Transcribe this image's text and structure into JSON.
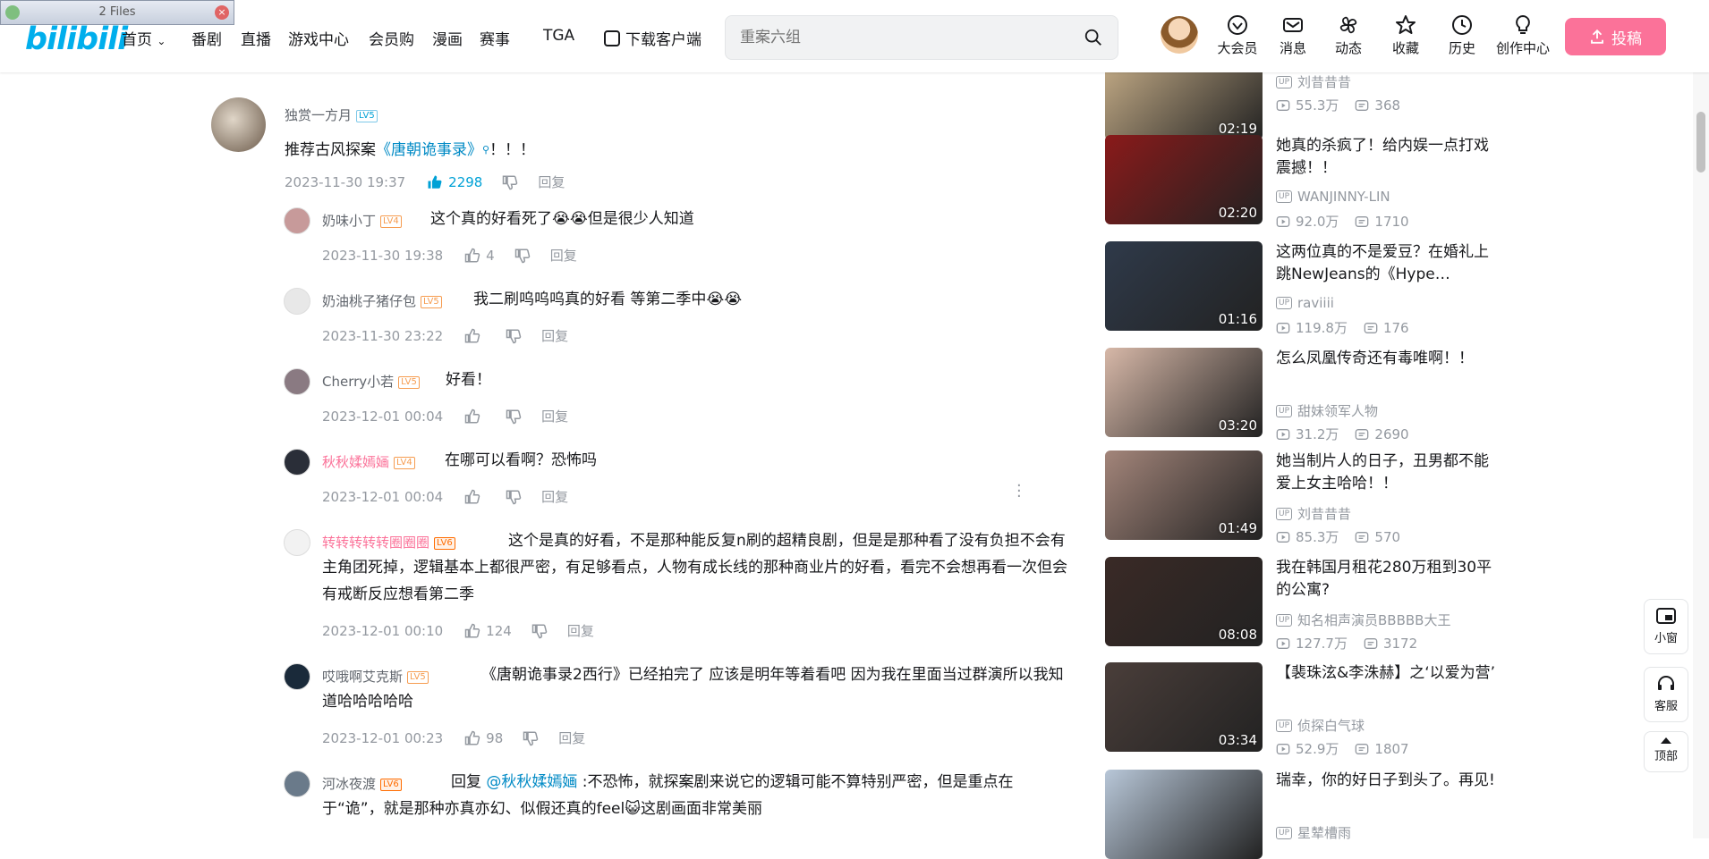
{
  "files_bar": {
    "label": "2 Files",
    "close": "×"
  },
  "header": {
    "logo": "bilibili",
    "nav": [
      {
        "label": "首页",
        "has_caret": true
      },
      {
        "label": "番剧"
      },
      {
        "label": "直播"
      },
      {
        "label": "游戏中心"
      },
      {
        "label": "会员购"
      },
      {
        "label": "漫画"
      },
      {
        "label": "赛事"
      },
      {
        "label": "TGA"
      },
      {
        "label": "下载客户端"
      }
    ],
    "search_placeholder": "重案六组",
    "icons": [
      {
        "label": "大会员",
        "icon": "vip-icon"
      },
      {
        "label": "消息",
        "icon": "message-icon"
      },
      {
        "label": "动态",
        "icon": "dynamic-icon"
      },
      {
        "label": "收藏",
        "icon": "favorite-icon"
      },
      {
        "label": "历史",
        "icon": "history-icon"
      },
      {
        "label": "创作中心",
        "icon": "creator-icon"
      }
    ],
    "upload_label": "投稿"
  },
  "comments": {
    "main": {
      "user": "独赏一方月",
      "level": "LV5",
      "text_before": "推荐古风探案",
      "link": "《唐朝诡事录》",
      "text_after": "！！！",
      "time": "2023-11-30 19:37",
      "likes": "2298",
      "reply_label": "回复"
    },
    "replies": [
      {
        "user": "奶味小丁",
        "level": "LV4",
        "text": "这个真的好看死了😭😭但是很少人知道",
        "time": "2023-11-30 19:38",
        "likes": "4",
        "reply_label": "回复"
      },
      {
        "user": "奶油桃子猪仔包",
        "level": "LV5",
        "text": "我二刷呜呜呜真的好看 等第二季中😭😭",
        "time": "2023-11-30 23:22",
        "likes": "",
        "reply_label": "回复"
      },
      {
        "user": "Cherry小若",
        "level": "LV5",
        "text": "好看！",
        "time": "2023-12-01 00:04",
        "likes": "",
        "reply_label": "回复"
      },
      {
        "user": "秋秋媃嫣婳",
        "level": "LV4",
        "text": "在哪可以看啊？恐怖吗",
        "time": "2023-12-01 00:04",
        "likes": "",
        "reply_label": "回复"
      },
      {
        "user": "转转转转转圈圈圈",
        "level": "LV6",
        "text": "这个是真的好看，不是那种能反复n刷的超精良剧，但是是那种看了没有负担不会有主角团死掉，逻辑基本上都很严密，有足够看点，人物有成长线的那种商业片的好看，看完不会想再看一次但会有戒断反应想看第二季",
        "time": "2023-12-01 00:10",
        "likes": "124",
        "reply_label": "回复"
      },
      {
        "user": "哎哦啊艾克斯",
        "level": "LV5",
        "text": "《唐朝诡事录2西行》已经拍完了 应该是明年等着看吧 因为我在里面当过群演所以我知道哈哈哈哈哈",
        "time": "2023-12-01 00:23",
        "likes": "98",
        "reply_label": "回复"
      },
      {
        "user": "河冰夜渡",
        "level": "LV6",
        "text_before": "回复 ",
        "mention": "@秋秋媃嫣婳",
        "text_after": " :不恐怖，就探案剧来说它的逻辑可能不算特别严密，但是重点在于“诡”，就是那种亦真亦幻、似假还真的feel😺这剧画面非常美丽"
      }
    ]
  },
  "recommendations": [
    {
      "title": "",
      "up": "刘昔昔昔",
      "views": "55.3万",
      "danmaku": "368",
      "duration": "02:19",
      "color": "#c9b08a"
    },
    {
      "title": "她真的杀疯了！给内娱一点打戏震撼！！",
      "up": "WANJINNY-LIN",
      "views": "92.0万",
      "danmaku": "1710",
      "duration": "02:20",
      "color": "#8a1a1a"
    },
    {
      "title": "这两位真的不是爱豆？在婚礼上跳NewJeans的《Hype…",
      "up": "raviiii",
      "views": "119.8万",
      "danmaku": "176",
      "duration": "01:16",
      "color": "#2f3a4a"
    },
    {
      "title": "怎么凤凰传奇还有毒唯啊！！",
      "up": "甜妹领军人物",
      "views": "31.2万",
      "danmaku": "2690",
      "duration": "03:20",
      "color": "#d7b8a8"
    },
    {
      "title": "她当制片人的日子，丑男都不能爱上女主哈哈！！",
      "up": "刘昔昔昔",
      "views": "85.3万",
      "danmaku": "570",
      "duration": "01:49",
      "color": "#a3857a"
    },
    {
      "title": "我在韩国月租花280万租到30平的公寓?",
      "up": "知名相声演员BBBBB大王",
      "views": "127.7万",
      "danmaku": "3172",
      "duration": "08:08",
      "color": "#3a2a26"
    },
    {
      "title": "【裴珠泫&李洙赫】之‘以爱为营’",
      "up": "侦探白气球",
      "views": "52.9万",
      "danmaku": "1807",
      "duration": "03:34",
      "color": "#4a3e3a"
    },
    {
      "title": "瑞幸，你的好日子到头了。再见!",
      "up": "星辇槽雨",
      "views": "",
      "danmaku": "",
      "duration": "",
      "color": "#b8c7d8"
    }
  ],
  "floating": {
    "mini_label": "小窗",
    "service_label": "客服",
    "top_label": "顶部"
  }
}
